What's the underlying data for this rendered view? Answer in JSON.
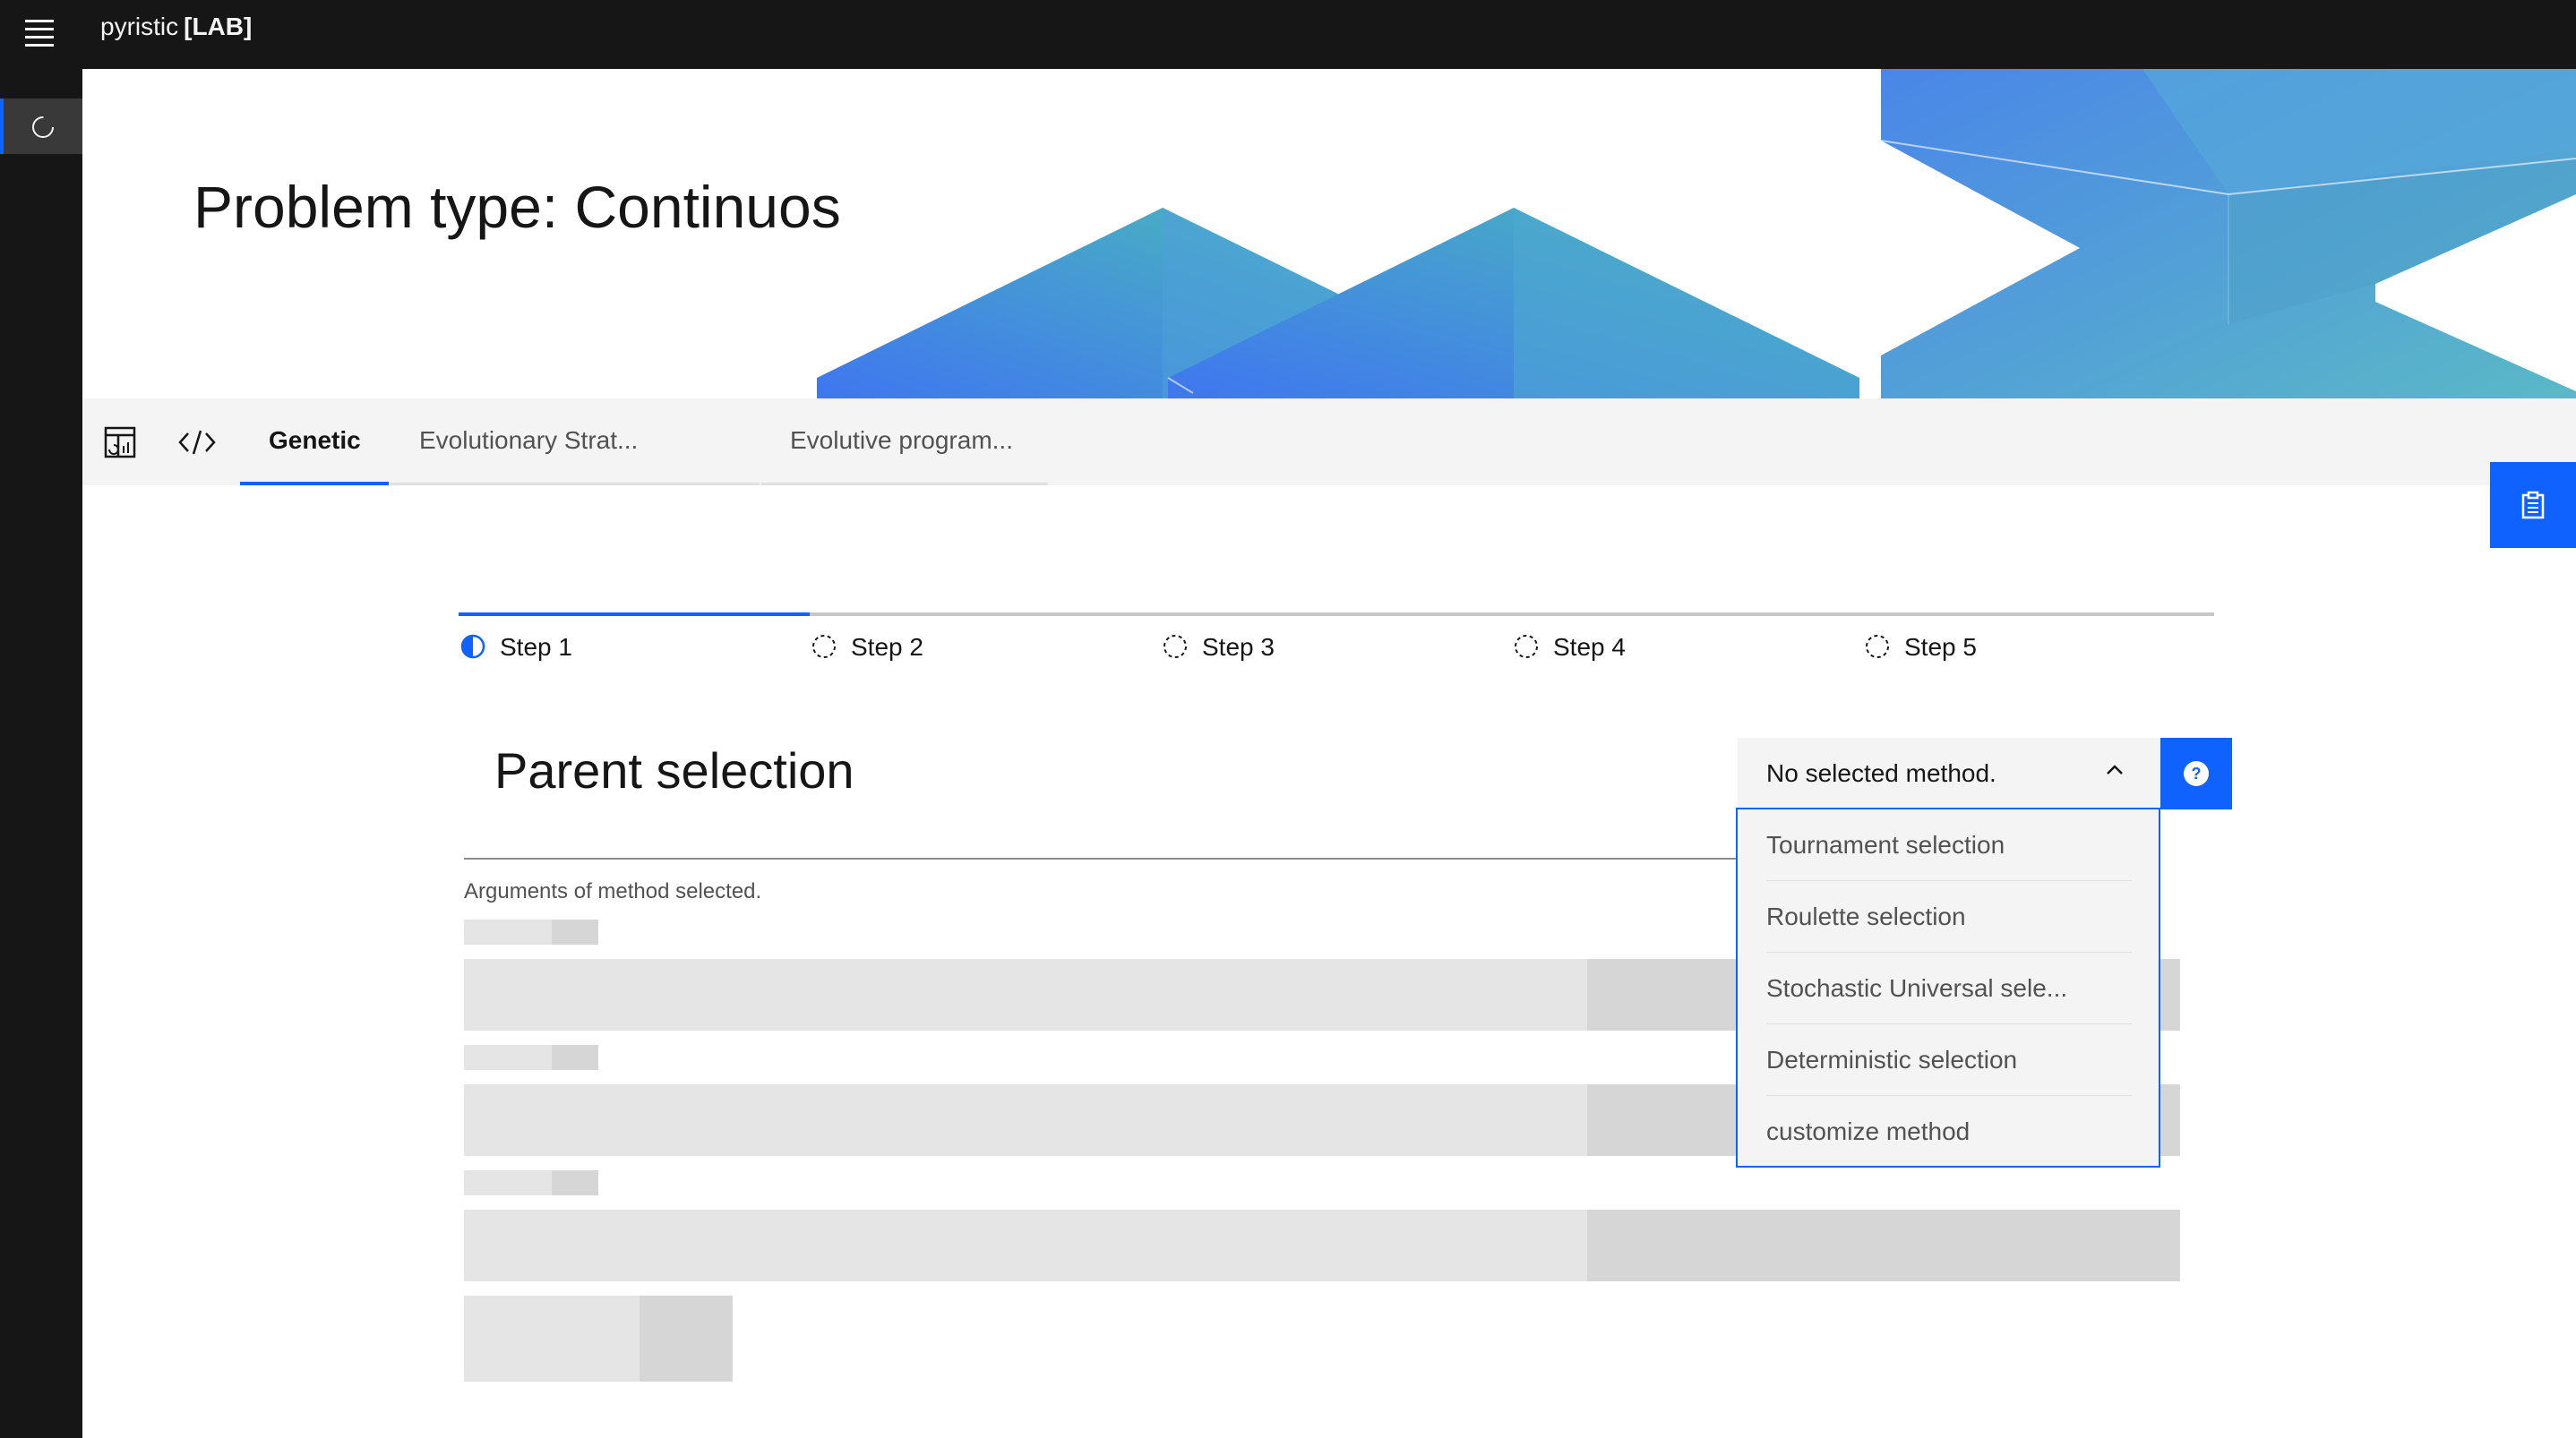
{
  "header": {
    "brand_name": "pyristic",
    "brand_suffix": "[LAB]",
    "menu_icon": "hamburger-menu-icon"
  },
  "siderail": {
    "items": [
      {
        "icon": "loading-circle-icon",
        "active": true
      }
    ]
  },
  "hero": {
    "title": "Problem type: Continuos"
  },
  "tabs": {
    "icon_tabs": [
      "dashboard-report-icon",
      "code-icon"
    ],
    "items": [
      {
        "label": "Genetic",
        "active": true
      },
      {
        "label": "Evolutionary Strat...",
        "active": false
      },
      {
        "label": "Evolutive program...",
        "active": false
      }
    ]
  },
  "float_button": {
    "icon": "clipboard-icon"
  },
  "steps": [
    {
      "label": "Step 1",
      "state": "current"
    },
    {
      "label": "Step 2",
      "state": "incomplete"
    },
    {
      "label": "Step 3",
      "state": "incomplete"
    },
    {
      "label": "Step 4",
      "state": "incomplete"
    },
    {
      "label": "Step 5",
      "state": "incomplete"
    }
  ],
  "section": {
    "title": "Parent selection",
    "args_label": "Arguments of method selected."
  },
  "dropdown": {
    "value": "No selected method.",
    "expanded": true,
    "options": [
      "Tournament selection",
      "Roulette selection",
      "Stochastic Universal sele...",
      "Deterministic selection",
      "customize method"
    ]
  },
  "help_button": {
    "icon": "help-icon"
  },
  "colors": {
    "accent": "#0f62fe",
    "header_bg": "#161616",
    "tabs_bg": "#f4f4f4",
    "skeleton": "#e5e5e5"
  }
}
